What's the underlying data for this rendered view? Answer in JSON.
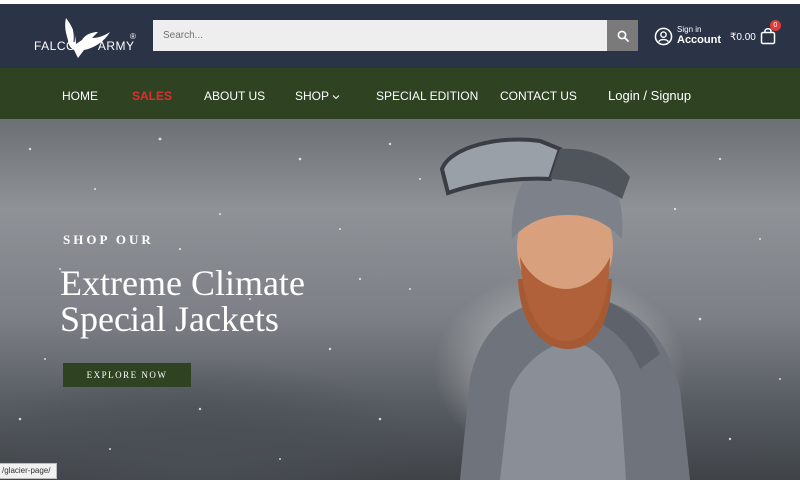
{
  "header": {
    "logo": {
      "left_text": "FALCO",
      "right_text": "ARMY",
      "reg_mark": "®"
    },
    "search": {
      "placeholder": "Search...",
      "value": ""
    },
    "account": {
      "small": "Sign in",
      "big": "Account"
    },
    "cart": {
      "amount": "₹0.00",
      "count": "0"
    }
  },
  "nav": {
    "items": [
      {
        "label": "HOME"
      },
      {
        "label": "SALES"
      },
      {
        "label": "ABOUT US"
      },
      {
        "label": "SHOP"
      },
      {
        "label": "SPECIAL EDITION"
      },
      {
        "label": "CONTACT US"
      },
      {
        "label": "Login / Signup"
      }
    ]
  },
  "hero": {
    "subtitle": "SHOP OUR",
    "title_line1": "Extreme Climate",
    "title_line2": "Special Jackets",
    "button": "EXPLORE NOW"
  },
  "status_bar": {
    "url": "/glacier-page/"
  },
  "colors": {
    "header_bg": "#2b3346",
    "nav_bg": "#2f4323",
    "sales_red": "#e22d2d",
    "badge_red": "#e53935"
  }
}
